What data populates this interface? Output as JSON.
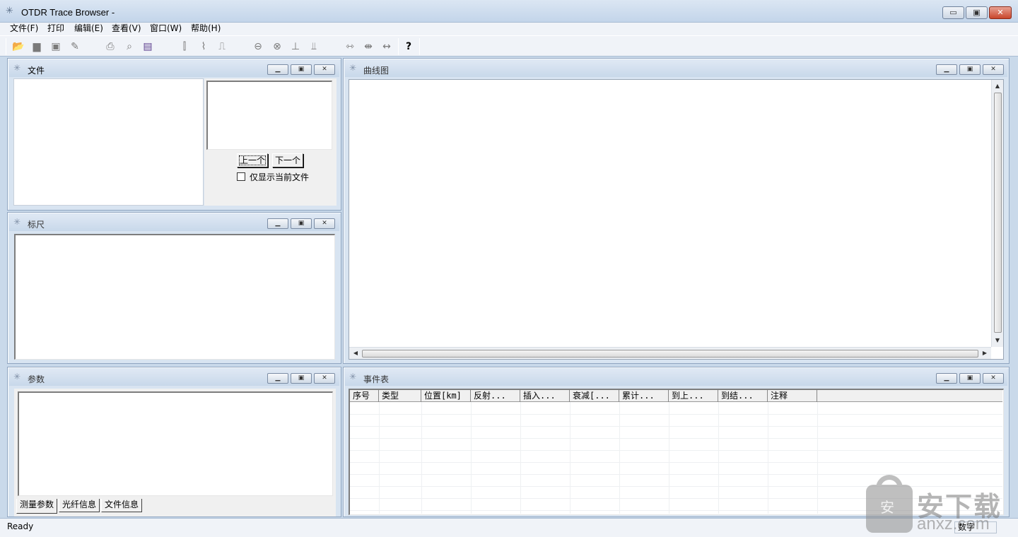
{
  "window": {
    "title": "OTDR Trace Browser -",
    "icon": "app-star-icon",
    "controls": {
      "minimize": "▭",
      "maximize": "▣",
      "close": "✕"
    }
  },
  "menu": [
    {
      "label": "文件(F)"
    },
    {
      "label": "打印"
    },
    {
      "label": "编辑(E)"
    },
    {
      "label": "查看(V)"
    },
    {
      "label": "窗口(W)"
    },
    {
      "label": "帮助(H)"
    }
  ],
  "toolbar": {
    "buttons": [
      {
        "icon": "open-folder-icon",
        "glyph": "📂"
      },
      {
        "icon": "folder-icon",
        "glyph": "▆"
      },
      {
        "icon": "save-icon",
        "glyph": "▣"
      },
      {
        "icon": "edit-icon",
        "glyph": "✎"
      },
      {
        "icon": "print-icon",
        "glyph": "⎙"
      },
      {
        "icon": "print-preview-icon",
        "glyph": "⌕"
      },
      {
        "icon": "page-setup-icon",
        "glyph": "▤"
      },
      {
        "icon": "marker-a-icon",
        "glyph": "⫿"
      },
      {
        "icon": "trace-step-icon",
        "glyph": "⌇"
      },
      {
        "icon": "trace-pulse-icon",
        "glyph": "⎍"
      },
      {
        "icon": "zoom-fit-icon",
        "glyph": "⊖"
      },
      {
        "icon": "zoom-reset-icon",
        "glyph": "⊗"
      },
      {
        "icon": "baseline-icon",
        "glyph": "⊥"
      },
      {
        "icon": "multi-baseline-icon",
        "glyph": "⫫"
      },
      {
        "icon": "event-left-icon",
        "glyph": "⇿"
      },
      {
        "icon": "event-both-icon",
        "glyph": "⇼"
      },
      {
        "icon": "event-span-icon",
        "glyph": "↔"
      },
      {
        "icon": "help-icon",
        "glyph": "?"
      }
    ]
  },
  "panels": {
    "files": {
      "title": "文件",
      "prev_button": "上一个",
      "next_button": "下一个",
      "only_current_label": "仅显示当前文件",
      "only_current_checked": false
    },
    "ruler": {
      "title": "标尺"
    },
    "params": {
      "title": "参数",
      "tabs": [
        "测量参数",
        "光纤信息",
        "文件信息"
      ],
      "active_tab": "测量参数"
    },
    "trace": {
      "title": "曲线图"
    },
    "events": {
      "title": "事件表",
      "columns": [
        "序号",
        "类型",
        "位置[km]",
        "反射...",
        "插入...",
        "衰减[...",
        "累计...",
        "到上...",
        "到结...",
        "注释"
      ],
      "rows": []
    }
  },
  "status": {
    "text": "Ready",
    "indicator": "数字"
  },
  "watermark": {
    "cn": "安下载",
    "en": "anxz.com",
    "lock_char": "安"
  },
  "colors": {
    "frame": "#c9d9ea",
    "caption": "#c8d8ea",
    "close_button": "#c9462c"
  }
}
